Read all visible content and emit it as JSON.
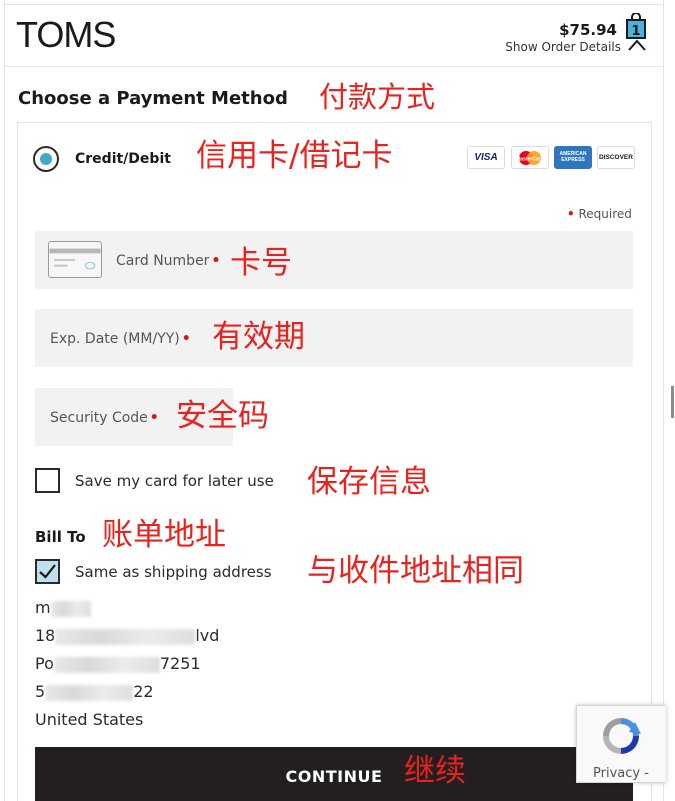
{
  "header": {
    "logo": "TOMS",
    "order_total": "$75.94",
    "order_details_label": "Show Order Details",
    "bag_count": "1"
  },
  "payment": {
    "title": "Choose a Payment Method",
    "method_label": "Credit/Debit",
    "card_brands": [
      "VISA",
      "MasterCard",
      "AMERICAN EXPRESS",
      "DISCOVER"
    ],
    "required_label": "Required",
    "fields": {
      "card_number": "Card Number",
      "exp_date": "Exp. Date (MM/YY)",
      "security_code": "Security Code"
    },
    "save_card_label": "Save my card for later use",
    "save_card_checked": false
  },
  "billing": {
    "title": "Bill To",
    "same_as_shipping_label": "Same as shipping address",
    "same_as_shipping_checked": true,
    "address": {
      "line1_start": "m",
      "line2_start": "18",
      "line2_end": "lvd",
      "line3_start": "Po",
      "line3_end": "7251",
      "line4_start": "5",
      "line4_end": "22",
      "country": "United States"
    }
  },
  "actions": {
    "continue_label": "CONTINUE"
  },
  "recaptcha": {
    "privacy_label": "Privacy -"
  },
  "annotations": {
    "payment_method": "付款方式",
    "credit_debit": "信用卡/借记卡",
    "card_number": "卡号",
    "exp_date": "有效期",
    "security_code": "安全码",
    "save_card": "保存信息",
    "bill_to": "账单地址",
    "same_as_shipping": "与收件地址相同",
    "continue": "继续"
  },
  "colors": {
    "accent_radio": "#3fa9c9",
    "checkbox_checked": "#bfe0ec",
    "required_dot": "#d21919",
    "continue_button": "#231f20",
    "annotation_red": "#e8231e"
  }
}
